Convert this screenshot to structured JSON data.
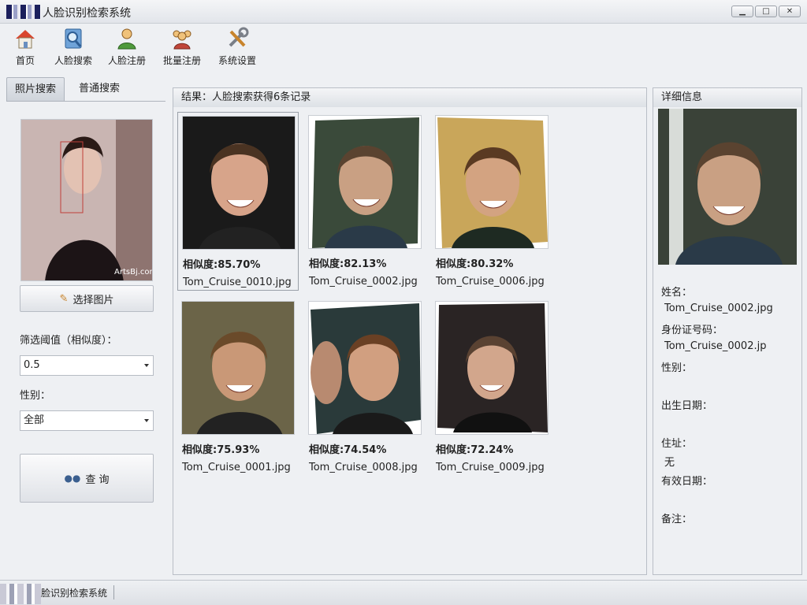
{
  "window": {
    "title": "人脸识别检索系统"
  },
  "toolbar": {
    "items": [
      {
        "label": "首页",
        "icon": "home-icon"
      },
      {
        "label": "人脸搜索",
        "icon": "face-search-icon"
      },
      {
        "label": "人脸注册",
        "icon": "person-register-icon"
      },
      {
        "label": "批量注册",
        "icon": "group-register-icon"
      },
      {
        "label": "系统设置",
        "icon": "tools-icon"
      }
    ]
  },
  "left": {
    "tabs": [
      "照片搜索",
      "普通搜索"
    ],
    "photo_watermark": "ArtsBj.com",
    "select_image_label": "选择图片",
    "threshold_label": "筛选阈值（相似度）：",
    "threshold_value": "0.5",
    "gender_label": "性别：",
    "gender_value": "全部",
    "query_label": "查 询"
  },
  "results": {
    "header": "结果：人脸搜索获得6条记录",
    "items": [
      {
        "similarity": "相似度:85.70%",
        "filename": "Tom_Cruise_0010.jpg"
      },
      {
        "similarity": "相似度:82.13%",
        "filename": "Tom_Cruise_0002.jpg"
      },
      {
        "similarity": "相似度:80.32%",
        "filename": "Tom_Cruise_0006.jpg"
      },
      {
        "similarity": "相似度:75.93%",
        "filename": "Tom_Cruise_0001.jpg"
      },
      {
        "similarity": "相似度:74.54%",
        "filename": "Tom_Cruise_0008.jpg"
      },
      {
        "similarity": "相似度:72.24%",
        "filename": "Tom_Cruise_0009.jpg"
      }
    ]
  },
  "details": {
    "header": "详细信息",
    "name_label": "姓名：",
    "name_value": "Tom_Cruise_0002.jpg",
    "id_label": "身份证号码：",
    "id_value": "Tom_Cruise_0002.jp",
    "gender_label": "性别：",
    "gender_value": "",
    "birth_label": "出生日期：",
    "birth_value": "",
    "address_label": "住址：",
    "address_value": "无",
    "valid_label": "有效日期：",
    "valid_value": "",
    "remark_label": "备注：",
    "remark_value": ""
  },
  "status": {
    "text": "脸识别检索系统"
  }
}
